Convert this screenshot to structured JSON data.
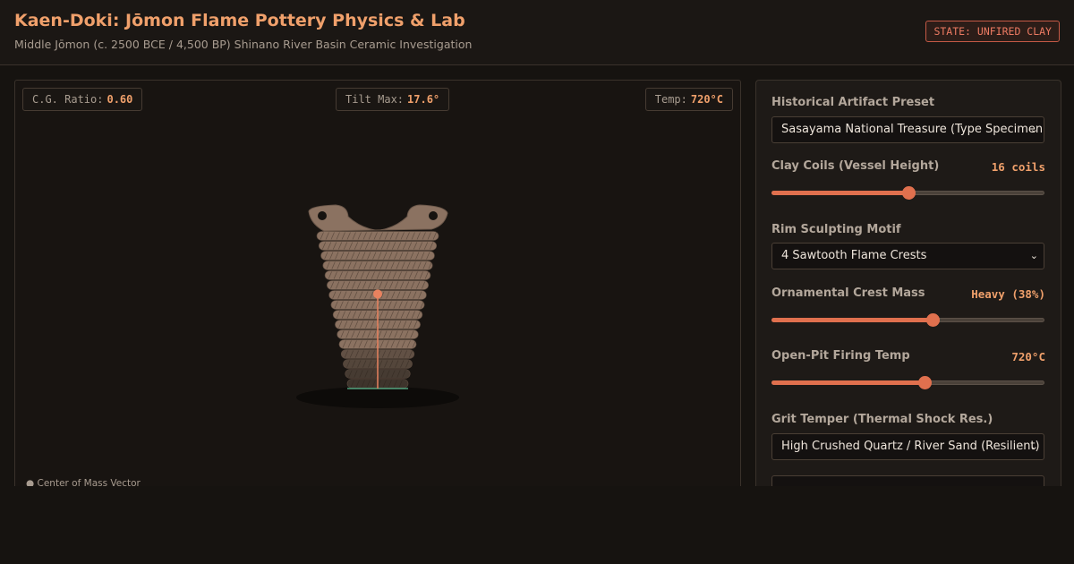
{
  "header": {
    "title": "Kaen-Doki: Jōmon Flame Pottery Physics & Lab",
    "subtitle": "Middle Jōmon (c. 2500 BCE / 4,500 BP) Shinano River Basin Ceramic Investigation",
    "state_badge": "STATE: UNFIRED CLAY"
  },
  "metrics": {
    "cg_label": "C.G. Ratio:",
    "cg_value": "0.60",
    "tilt_label": "Tilt Max:",
    "tilt_value": "17.6°",
    "temp_label": "Temp:",
    "temp_value": "720°C"
  },
  "vessel": {
    "coils": 16,
    "center_of_mass_ratio": 0.6,
    "legend": "● Center of Mass Vector",
    "colors": {
      "clay": "#8b7261",
      "clay_dark": "#3e342c",
      "cg_marker": "#e8825f",
      "base_line": "#4fa07c"
    }
  },
  "controls": {
    "preset": {
      "label": "Historical Artifact Preset",
      "value": "Sasayama National Treasure (Type Specimen)"
    },
    "coils": {
      "label": "Clay Coils (Vessel Height)",
      "value": "16 coils",
      "level": 0.5
    },
    "motif": {
      "label": "Rim Sculpting Motif",
      "value": "4 Sawtooth Flame Crests"
    },
    "crest_mass": {
      "label": "Ornamental Crest Mass",
      "value": "Heavy (38%)",
      "level": 0.59
    },
    "firing_temp": {
      "label": "Open-Pit Firing Temp",
      "value": "720°C",
      "level": 0.56
    },
    "grit": {
      "label": "Grit Temper (Thermal Shock Res.)",
      "value": "High Crushed Quartz / River Sand (Resilient)"
    }
  },
  "colors": {
    "accent": "#f0a06b",
    "slider": "#e0704e",
    "badge": "#ec7a62",
    "background": "#161310"
  }
}
